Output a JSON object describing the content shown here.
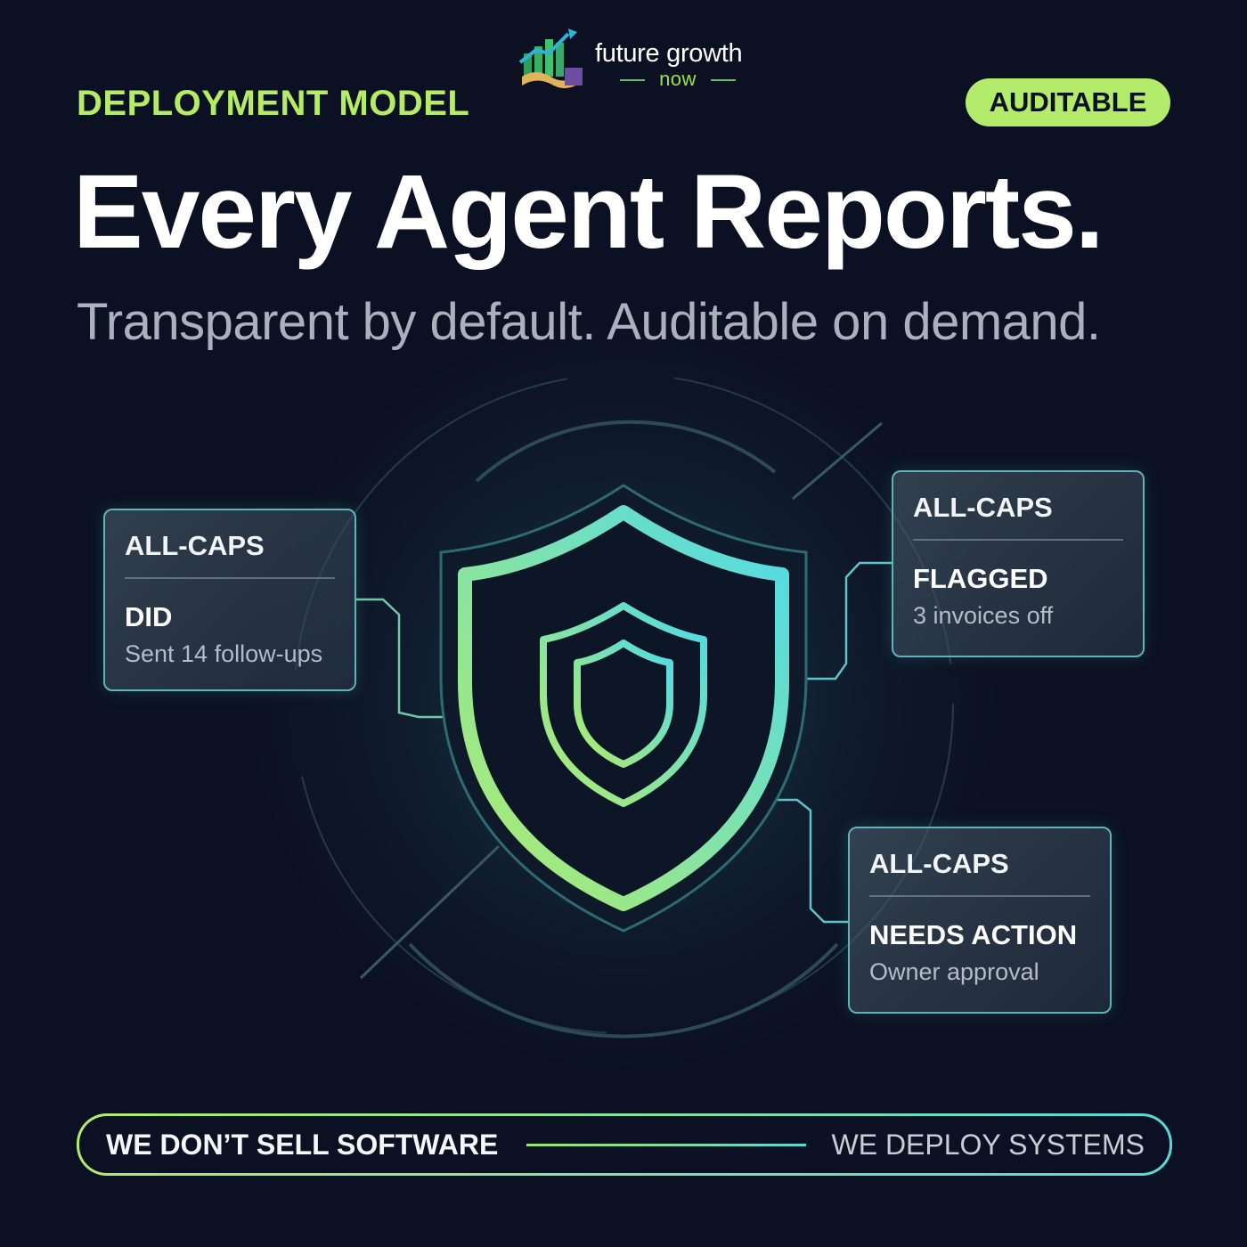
{
  "brand": {
    "name": "future growth",
    "tagline": "now"
  },
  "header": {
    "eyebrow": "DEPLOYMENT MODEL",
    "badge": "AUDITABLE",
    "headline": "Every Agent Reports.",
    "subhead": "Transparent by default. Auditable on demand."
  },
  "cards": [
    {
      "header": "ALL-CAPS",
      "title": "DID",
      "detail": "Sent 14 follow-ups"
    },
    {
      "header": "ALL-CAPS",
      "title": "FLAGGED",
      "detail": "3 invoices off"
    },
    {
      "header": "ALL-CAPS",
      "title": "NEEDS ACTION",
      "detail": "Owner approval"
    }
  ],
  "footer": {
    "left": "WE DON’T SELL SOFTWARE",
    "right": "WE DEPLOY SYSTEMS"
  },
  "colors": {
    "background": "#0b1122",
    "accent_green": "#b3ec6a",
    "accent_cyan": "#59d7d9",
    "card_border": "#5fb3bb"
  },
  "icons": {
    "logo": "growth-chart-handshake-icon",
    "center": "shield-icon"
  }
}
